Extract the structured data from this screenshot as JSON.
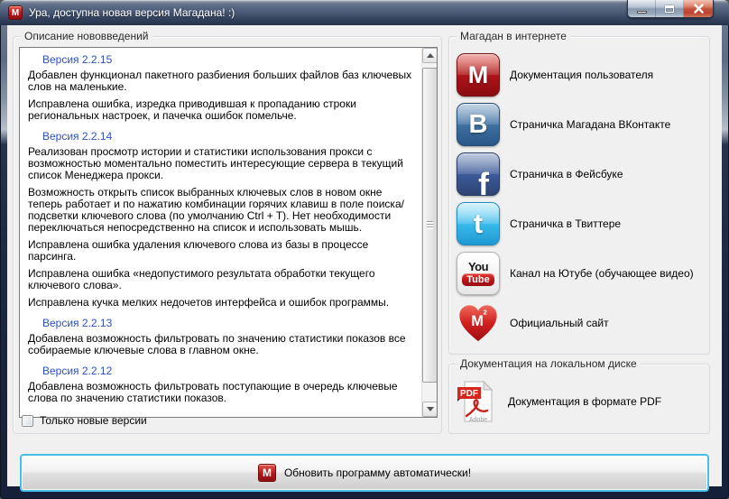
{
  "window": {
    "title": "Ура, доступна новая версия Магадана! :)",
    "icon_letter": "M"
  },
  "changelog": {
    "group_title": "Описание нововведений",
    "entries": [
      {
        "type": "version",
        "text": "Версия 2.2.15"
      },
      {
        "type": "text",
        "text": "Добавлен функционал пакетного разбиения больших файлов баз ключевых слов на маленькие."
      },
      {
        "type": "text",
        "text": "Исправлена ошибка, изредка приводившая к пропаданию строки региональных настроек, и пачечка ошибок помельче."
      },
      {
        "type": "version",
        "text": "Версия 2.2.14"
      },
      {
        "type": "text",
        "text": "Реализован просмотр истории и статистики использования прокси с возможностью моментально поместить интересующие сервера в текущий список Менеджера прокси."
      },
      {
        "type": "text",
        "text": "Возможность открыть список выбранных ключевых слов в новом окне теперь работает и по нажатию комбинации горячих клавиш в поле поиска/подсветки ключевого слова (по умолчанию Ctrl + T). Нет необходимости переключаться непосредственно на список и использовать мышь."
      },
      {
        "type": "text",
        "text": "Исправлена ошибка удаления ключевого слова из базы в процессе парсинга."
      },
      {
        "type": "text",
        "text": "Исправлена ошибка «недопустимого результата обработки текущего ключевого слова»."
      },
      {
        "type": "text",
        "text": "Исправлена кучка мелких недочетов интерфейса и ошибок программы."
      },
      {
        "type": "version",
        "text": "Версия 2.2.13"
      },
      {
        "type": "text",
        "text": "Добавлена возможность фильтровать по значению статистики показов все собираемые ключевые слова в главном окне."
      },
      {
        "type": "version",
        "text": "Версия 2.2.12"
      },
      {
        "type": "text",
        "text": "Добавлена возможность фильтровать поступающие в очередь ключевые слова по значению статистики показов."
      }
    ],
    "only_new_versions": {
      "label": "Только новые версии",
      "checked": false
    }
  },
  "internet": {
    "group_title": "Магадан в интернете",
    "links": [
      {
        "icon": "magadan-icon",
        "icon_letter": "M",
        "label": "Документация пользователя"
      },
      {
        "icon": "vk-icon",
        "icon_letter": "В",
        "label": "Страничка Магадана ВКонтакте"
      },
      {
        "icon": "facebook-icon",
        "icon_letter": "f",
        "label": "Страничка в Фейсбуке"
      },
      {
        "icon": "twitter-icon",
        "icon_letter": "t",
        "label": "Страничка в Твиттере"
      },
      {
        "icon": "youtube-icon",
        "icon_text_top": "You",
        "icon_text_bottom": "Tube",
        "label": "Канал на Ютубе (обучающее видео)"
      },
      {
        "icon": "heart-icon",
        "icon_letter": "M",
        "icon_sup": "2",
        "label": "Официальный сайт"
      }
    ]
  },
  "local_docs": {
    "group_title": "Документация на локальном диске",
    "links": [
      {
        "icon": "pdf-icon",
        "icon_banner": "PDF",
        "icon_brand": "Adobe",
        "label": "Документация в формате PDF"
      }
    ]
  },
  "update_button": {
    "icon_letter": "M",
    "label": "Обновить программу автоматически!"
  },
  "colors": {
    "magadan_red": "#b31217",
    "vk_blue": "#3c6e9f",
    "facebook_blue": "#3b5998",
    "twitter_cyan": "#35b8e9",
    "youtube_red": "#b31217",
    "version_heading_blue": "#2b50c6",
    "update_button_border": "#45c0ea",
    "titlebar_dark": "#2e3c56",
    "client_background": "#f0f0f0"
  }
}
